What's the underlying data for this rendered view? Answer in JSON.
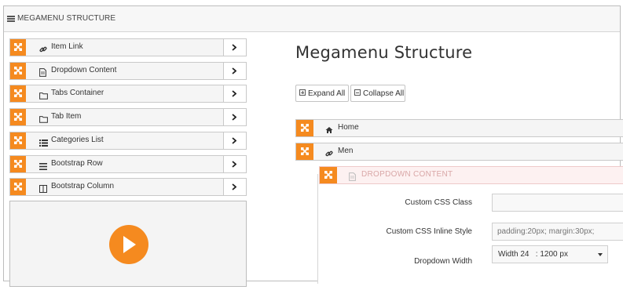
{
  "app": {
    "title": "MEGAMENU STRUCTURE"
  },
  "palette": {
    "items": [
      {
        "label": "Item Link",
        "icon": "link-icon"
      },
      {
        "label": "Dropdown Content",
        "icon": "file-icon"
      },
      {
        "label": "Tabs Container",
        "icon": "folder-icon"
      },
      {
        "label": "Tab Item",
        "icon": "folder-icon"
      },
      {
        "label": "Categories List",
        "icon": "list-icon"
      },
      {
        "label": "Bootstrap Row",
        "icon": "bars-icon"
      },
      {
        "label": "Bootstrap Column",
        "icon": "columns-icon"
      }
    ]
  },
  "main": {
    "heading": "Megamenu Structure",
    "expand_all": "Expand All",
    "collapse_all": "Collapse All",
    "tree": [
      {
        "label": "Home",
        "icon": "home-icon"
      },
      {
        "label": "Men",
        "icon": "link-icon"
      },
      {
        "label": "DROPDOWN CONTENT",
        "icon": "file-icon"
      }
    ],
    "form": {
      "css_class_label": "Custom CSS Class",
      "css_class_value": "",
      "inline_style_label": "Custom CSS Inline Style",
      "inline_style_placeholder": "padding:20px; margin:30px;",
      "width_label": "Dropdown Width",
      "width_value": "Width 24   : 1200 px"
    }
  },
  "colors": {
    "accent": "#f58a1f"
  }
}
